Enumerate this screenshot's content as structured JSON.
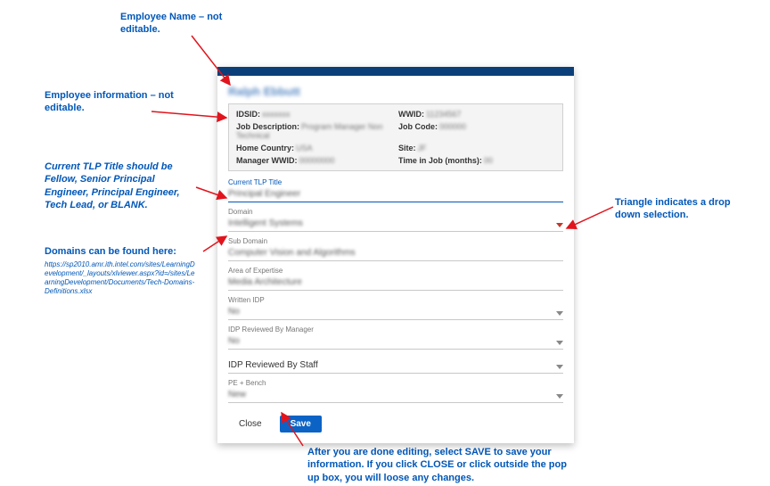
{
  "annotations": {
    "emp_name": "Employee Name – not editable.",
    "emp_info": "Employee information – not editable.",
    "tlp_title": "Current TLP Title should be Fellow, Senior Principal Engineer, Principal Engineer, Tech Lead, or BLANK.",
    "domains_intro": "Domains can be found here:",
    "domains_link": "https://sp2010.amr.ith.intel.com/sites/LearningDevelopment/_layouts/xlviewer.aspx?id=/sites/LearningDevelopment/Documents/Tech-Domains-Definitions.xlsx",
    "dropdown": "Triangle indicates a drop down selection.",
    "save_note": "After you are done editing, select SAVE to save your information. If you click CLOSE or click outside the pop up box, you will loose any changes."
  },
  "modal": {
    "employee_name": "Ralph Ebbutt",
    "info": {
      "idsid_label": "IDSID:",
      "idsid_value": "xxxxxxx",
      "wwid_label": "WWID:",
      "wwid_value": "11234567",
      "jobdesc_label": "Job Description:",
      "jobdesc_value": "Program Manager Non Technical",
      "jobcode_label": "Job Code:",
      "jobcode_value": "000000",
      "home_label": "Home Country:",
      "home_value": "USA",
      "site_label": "Site:",
      "site_value": "JF",
      "mgr_label": "Manager WWID:",
      "mgr_value": "00000000",
      "time_label": "Time in Job (months):",
      "time_value": "00"
    },
    "fields": {
      "tlp_label": "Current TLP Title",
      "tlp_value": "Principal Engineer",
      "domain_label": "Domain",
      "domain_value": "Intelligent Systems",
      "subdomain_label": "Sub Domain",
      "subdomain_value": "Computer Vision and Algorithms",
      "expertise_label": "Area of Expertise",
      "expertise_value": "Media Architecture",
      "written_label": "Written IDP",
      "written_value": "No",
      "mgr_review_label": "IDP Reviewed By Manager",
      "mgr_review_value": "No",
      "staff_review_label": "IDP Reviewed By Staff",
      "staff_review_value": "",
      "pebench_label": "PE + Bench",
      "pebench_value": "New"
    },
    "buttons": {
      "close": "Close",
      "save": "Save"
    }
  }
}
